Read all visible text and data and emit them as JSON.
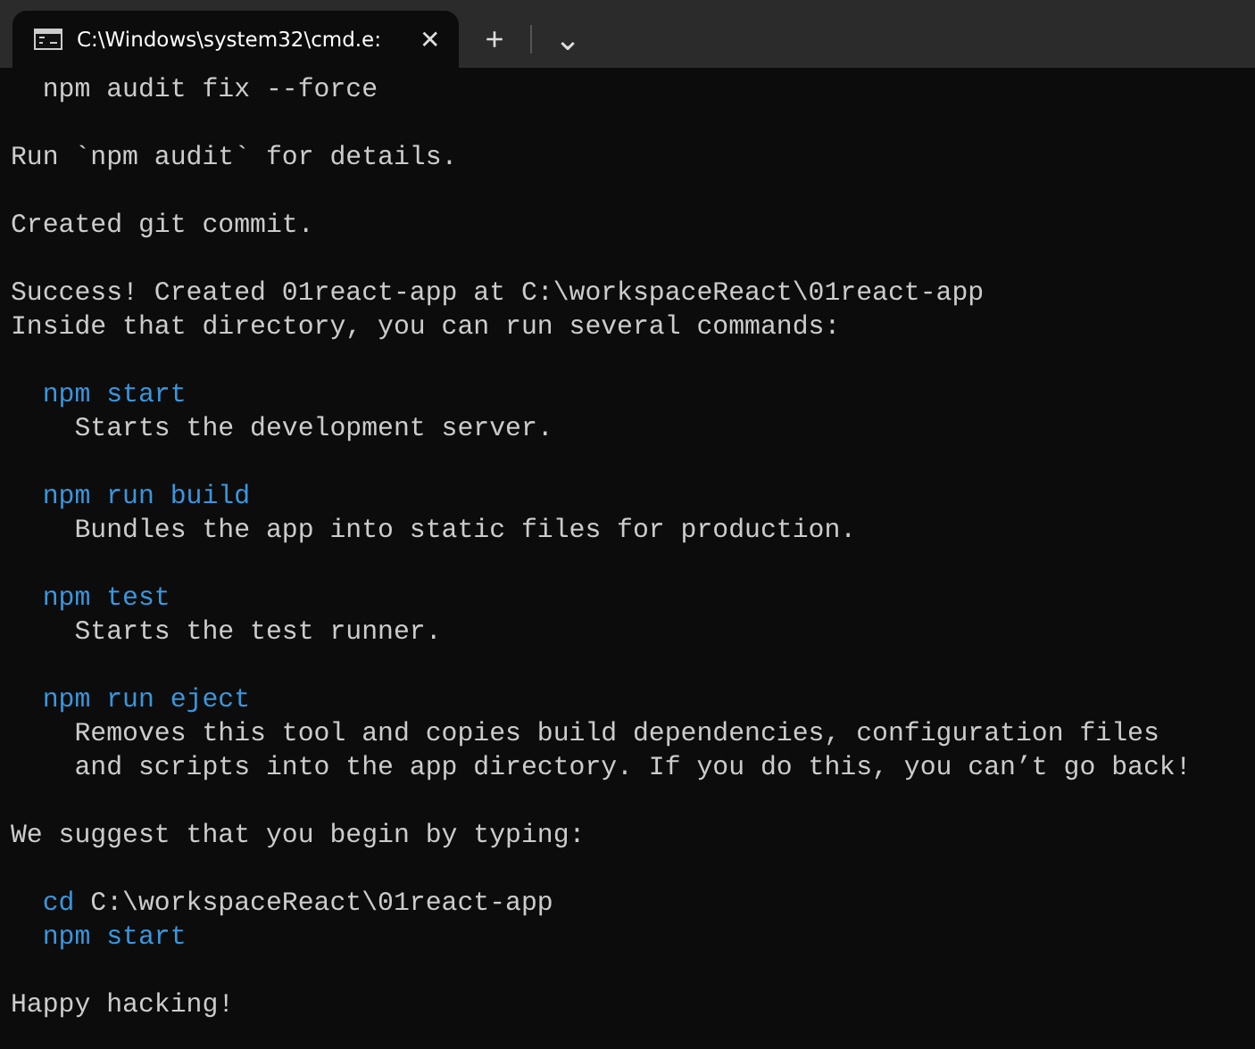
{
  "tabs": [
    {
      "title": "C:\\Windows\\system32\\cmd.e:",
      "selected": true,
      "close": "✕"
    }
  ],
  "tab_actions": {
    "new_tab": "+",
    "dropdown": "⌄"
  },
  "paragraphs": [
    {
      "lines": [
        [
          {
            "kind": "plain",
            "text": "  npm audit fix --force"
          }
        ]
      ]
    },
    {
      "lines": [
        [
          {
            "kind": "plain",
            "text": "Run `npm audit` for details."
          }
        ]
      ]
    },
    {
      "lines": [
        [
          {
            "kind": "plain",
            "text": "Created git commit."
          }
        ]
      ]
    },
    {
      "lines": [
        [
          {
            "kind": "plain",
            "text": "Success! Created 01react-app at C:\\workspaceReact\\01react-app"
          }
        ],
        [
          {
            "kind": "plain",
            "text": "Inside that directory, you can run several commands:"
          }
        ]
      ]
    },
    {
      "lines": [
        [
          {
            "kind": "command",
            "text": "  npm start"
          }
        ],
        [
          {
            "kind": "plain",
            "text": "    Starts the development server."
          }
        ]
      ]
    },
    {
      "lines": [
        [
          {
            "kind": "command",
            "text": "  npm run build"
          }
        ],
        [
          {
            "kind": "plain",
            "text": "    Bundles the app into static files for production."
          }
        ]
      ]
    },
    {
      "lines": [
        [
          {
            "kind": "command",
            "text": "  npm test"
          }
        ],
        [
          {
            "kind": "plain",
            "text": "    Starts the test runner."
          }
        ]
      ]
    },
    {
      "lines": [
        [
          {
            "kind": "command",
            "text": "  npm run eject"
          }
        ],
        [
          {
            "kind": "plain",
            "text": "    Removes this tool and copies build dependencies, configuration files"
          }
        ],
        [
          {
            "kind": "plain",
            "text": "    and scripts into the app directory. If you do this, you can’t go back!"
          }
        ]
      ]
    },
    {
      "lines": [
        [
          {
            "kind": "plain",
            "text": "We suggest that you begin by typing:"
          }
        ]
      ]
    },
    {
      "lines": [
        [
          {
            "kind": "command",
            "text": "  cd"
          },
          {
            "kind": "plain",
            "text": " C:\\workspaceReact\\01react-app"
          }
        ],
        [
          {
            "kind": "command",
            "text": "  npm start"
          }
        ]
      ]
    },
    {
      "lines": [
        [
          {
            "kind": "plain",
            "text": "Happy hacking!"
          }
        ]
      ]
    }
  ]
}
